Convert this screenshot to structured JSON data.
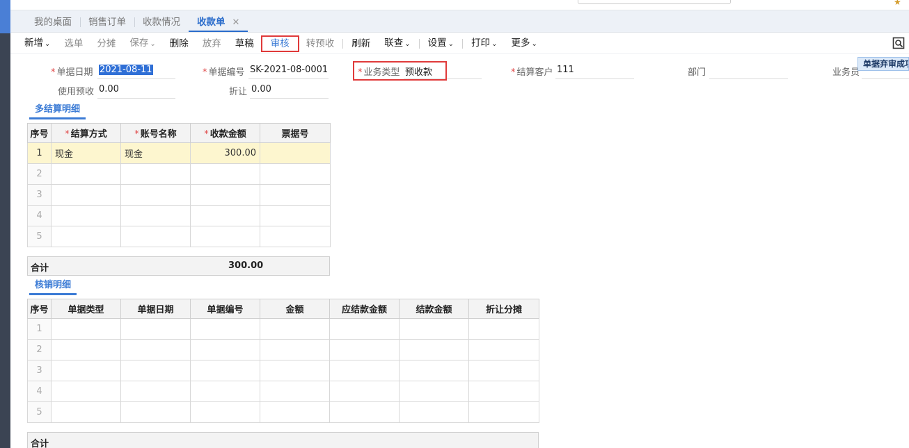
{
  "header": {
    "search_placeholder": ""
  },
  "tabs": [
    {
      "label": "我的桌面"
    },
    {
      "label": "销售订单"
    },
    {
      "label": "收款情况"
    },
    {
      "label": "收款单",
      "close": "✕"
    }
  ],
  "toolbar": {
    "new": "新增",
    "select": "选单",
    "split": "分摊",
    "save": "保存",
    "delete": "删除",
    "abandon": "放弃",
    "draft": "草稿",
    "audit": "审核",
    "to_prepay": "转预收",
    "refresh": "刷新",
    "link": "联查",
    "settings": "设置",
    "print": "打印",
    "more": "更多",
    "caret": "⌄",
    "right_icon": "preview-icon"
  },
  "form": {
    "bill_date": {
      "label": "单据日期",
      "value": "2021-08-11"
    },
    "bill_no": {
      "label": "单据编号",
      "value": "SK-2021-08-0001"
    },
    "biz_type": {
      "label": "业务类型",
      "value": "预收款"
    },
    "customer": {
      "label": "结算客户",
      "value": "111"
    },
    "dept": {
      "label": "部门",
      "value": ""
    },
    "salesman": {
      "label": "业务员",
      "value": ""
    },
    "use_prepay": {
      "label": "使用预收",
      "value": "0.00"
    },
    "discount": {
      "label": "折让",
      "value": "0.00"
    }
  },
  "toast": "单据弃审成功",
  "settlement": {
    "title": "多结算明细",
    "columns": [
      "序号",
      "结算方式",
      "账号名称",
      "收款金额",
      "票据号"
    ],
    "rows": [
      {
        "idx": "1",
        "method": "现金",
        "account": "现金",
        "amount": "300.00",
        "note": ""
      },
      {
        "idx": "2",
        "method": "",
        "account": "",
        "amount": "",
        "note": ""
      },
      {
        "idx": "3",
        "method": "",
        "account": "",
        "amount": "",
        "note": ""
      },
      {
        "idx": "4",
        "method": "",
        "account": "",
        "amount": "",
        "note": ""
      },
      {
        "idx": "5",
        "method": "",
        "account": "",
        "amount": "",
        "note": ""
      }
    ],
    "total_label": "合计",
    "total_value": "300.00"
  },
  "writeoff": {
    "title": "核销明细",
    "columns": [
      "序号",
      "单据类型",
      "单据日期",
      "单据编号",
      "金额",
      "应结款金额",
      "结款金额",
      "折让分摊"
    ],
    "rows": [
      {
        "idx": "1"
      },
      {
        "idx": "2"
      },
      {
        "idx": "3"
      },
      {
        "idx": "4"
      },
      {
        "idx": "5"
      }
    ],
    "total_label": "合计"
  }
}
